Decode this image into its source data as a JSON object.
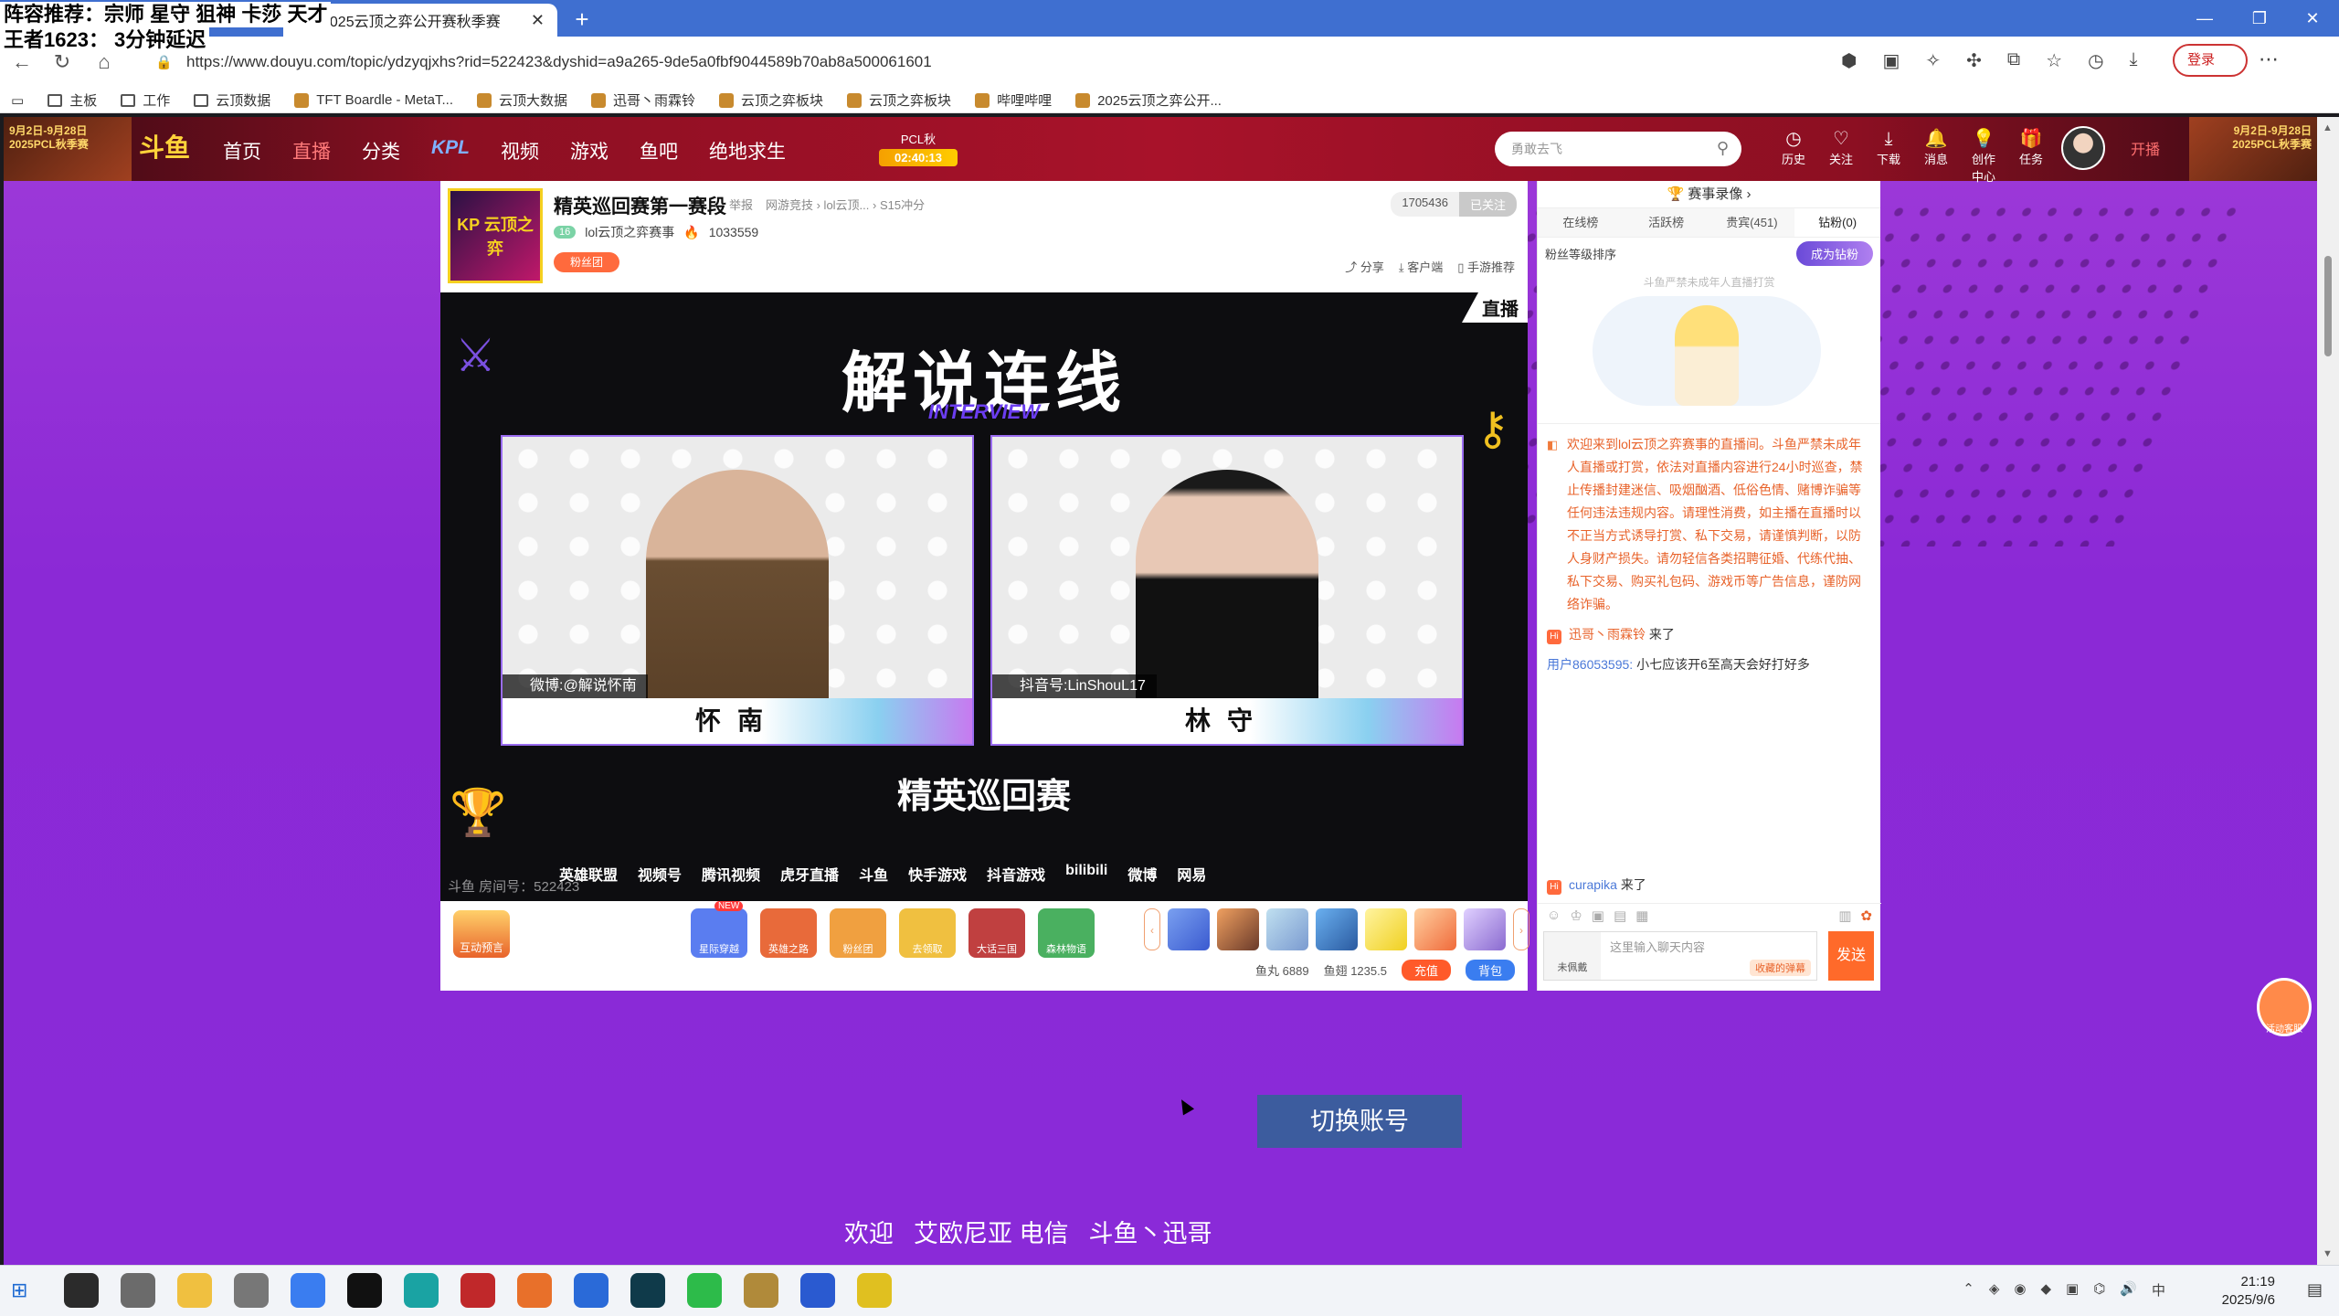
{
  "overlay": {
    "line1": "阵容推荐：宗师 星守 狙神 卡莎 天才",
    "line2": "王者1623：    3分钟延迟"
  },
  "browser": {
    "tab_title": "2025云顶之弈公开赛秋季赛",
    "url": "https://www.douyu.com/topic/ydzyqjxhs?rid=522423&dyshid=a9a265-9de5a0fbf9044589b70ab8a500061601",
    "login_label": "登录",
    "bookmarks": [
      "主板",
      "工作",
      "云顶数据",
      "TFT Boardle - MetaT...",
      "云顶大数据",
      "迅哥丶雨霖铃",
      "云顶之弈板块",
      "云顶之弈板块",
      "哔哩哔哩",
      "2025云顶之弈公开..."
    ]
  },
  "header": {
    "banner_left": "9月2日-9月28日 2025PCL秋季赛",
    "banner_right": "9月2日-9月28日 2025PCL秋季赛",
    "logo": "斗鱼",
    "nav": [
      "首页",
      "直播",
      "分类",
      "KPL",
      "视频",
      "游戏",
      "鱼吧",
      "绝地求生"
    ],
    "pcl_label": "PCL秋",
    "pcl_time": "02:40:13",
    "search_placeholder": "勇敢去飞",
    "tools": [
      {
        "glyph": "◷",
        "label": "历史"
      },
      {
        "glyph": "♡",
        "label": "关注"
      },
      {
        "glyph": "⤓",
        "label": "下载"
      },
      {
        "glyph": "🔔",
        "label": "消息"
      },
      {
        "glyph": "💡",
        "label": "创作中心"
      },
      {
        "glyph": "🎁",
        "label": "任务"
      }
    ],
    "open_live": "开播"
  },
  "room": {
    "avatar_text": "KP 云顶之弈",
    "title": "精英巡回赛第一赛段",
    "report": "举报",
    "category": "网游竞技 › lol云顶... › S15冲分",
    "anchor_name": "lol云顶之弈赛事",
    "anchor_level": "16",
    "hot": "1033559",
    "fans_label": "粉丝团",
    "follow_count": "1705436",
    "follow_label": "已关注",
    "actions": [
      "分享",
      "客户端",
      "手游推荐"
    ]
  },
  "video": {
    "live_tag": "直播",
    "title": "解说连线",
    "subtitle": "INTERVIEW",
    "left_tag": "微博:@解说怀南",
    "left_name": "怀南",
    "right_tag": "抖音号:LinShouL17",
    "right_name": "林守",
    "brand": "精英巡回赛",
    "sponsors": [
      "英雄联盟",
      "视频号",
      "腾讯视频",
      "虎牙直播",
      "斗鱼",
      "快手游戏",
      "抖音游戏",
      "bilibili",
      "微博",
      "网易"
    ],
    "room_no": "斗鱼 房间号：522423"
  },
  "gifts": {
    "left_label": "互动预言",
    "items": [
      {
        "label": "星际穿越",
        "color": "#5a7df0",
        "badge": "NEW"
      },
      {
        "label": "英雄之路",
        "color": "#e86a3a",
        "badge": ""
      },
      {
        "label": "粉丝团",
        "color": "#f0a040",
        "badge": ""
      },
      {
        "label": "去领取",
        "color": "#f0c040",
        "badge": ""
      },
      {
        "label": "大话三国",
        "color": "#c04040",
        "badge": ""
      },
      {
        "label": "森林物语",
        "color": "#4ab060",
        "badge": ""
      }
    ],
    "fishball_label": "鱼丸",
    "fishball": "6889",
    "fishfin_label": "鱼翅",
    "fishfin": "1235.5",
    "charge": "充值",
    "pack": "背包"
  },
  "chat": {
    "record": "赛事录像",
    "tabs": [
      "在线榜",
      "活跃榜",
      "贵宾(451)",
      "钻粉(0)"
    ],
    "fan_rank": "粉丝等级排序",
    "become_diamond": "成为钻粉",
    "empty_text": "斗鱼严禁未成年人直播打赏",
    "system_msg": "欢迎来到lol云顶之弈赛事的直播间。斗鱼严禁未成年人直播或打赏，依法对直播内容进行24小时巡查，禁止传播封建迷信、吸烟酗酒、低俗色情、赌博诈骗等任何违法违规内容。请理性消费，如主播在直播时以不正当方式诱导打赏、私下交易，请谨慎判断，以防人身财产损失。请勿轻信各类招聘征婚、代练代抽、私下交易、购买礼包码、游戏币等广告信息，谨防网络诈骗。",
    "msg1_user": "迅哥丶雨霖铃",
    "msg1_text": "来了",
    "msg2_user": "用户86053595:",
    "msg2_text": "小七应该开6至高天会好打好多",
    "msg3_user": "curapika",
    "msg3_text": "来了",
    "input_badge": "未佩戴",
    "input_placeholder": "这里输入聊天内容",
    "fav_danmu": "收藏的弹幕",
    "send": "发送"
  },
  "footer": {
    "welcome": [
      "欢迎",
      "艾欧尼亚 电信",
      "斗鱼丶迅哥"
    ],
    "switch_account": "切换账号",
    "cs_label": "活动客服"
  },
  "taskbar": {
    "time": "21:19",
    "date": "2025/9/6",
    "apps": [
      {
        "name": "search",
        "color": "#2b2b2b"
      },
      {
        "name": "task-view",
        "color": "#6b6b6b"
      },
      {
        "name": "explorer",
        "color": "#f0c040"
      },
      {
        "name": "microphone",
        "color": "#777"
      },
      {
        "name": "app-blue",
        "color": "#3a7df0"
      },
      {
        "name": "app-z",
        "color": "#111"
      },
      {
        "name": "edge",
        "color": "#1aa3a3"
      },
      {
        "name": "app-red",
        "color": "#c0282a"
      },
      {
        "name": "app-orange",
        "color": "#e8702a"
      },
      {
        "name": "app-blue2",
        "color": "#2a6ad8"
      },
      {
        "name": "app-dark",
        "color": "#0f3a4a"
      },
      {
        "name": "wechat",
        "color": "#2dbb4a"
      },
      {
        "name": "app-lol",
        "color": "#b08a3a"
      },
      {
        "name": "app-cube",
        "color": "#2a5ad0"
      },
      {
        "name": "app-yellow",
        "color": "#e0c020"
      }
    ]
  }
}
